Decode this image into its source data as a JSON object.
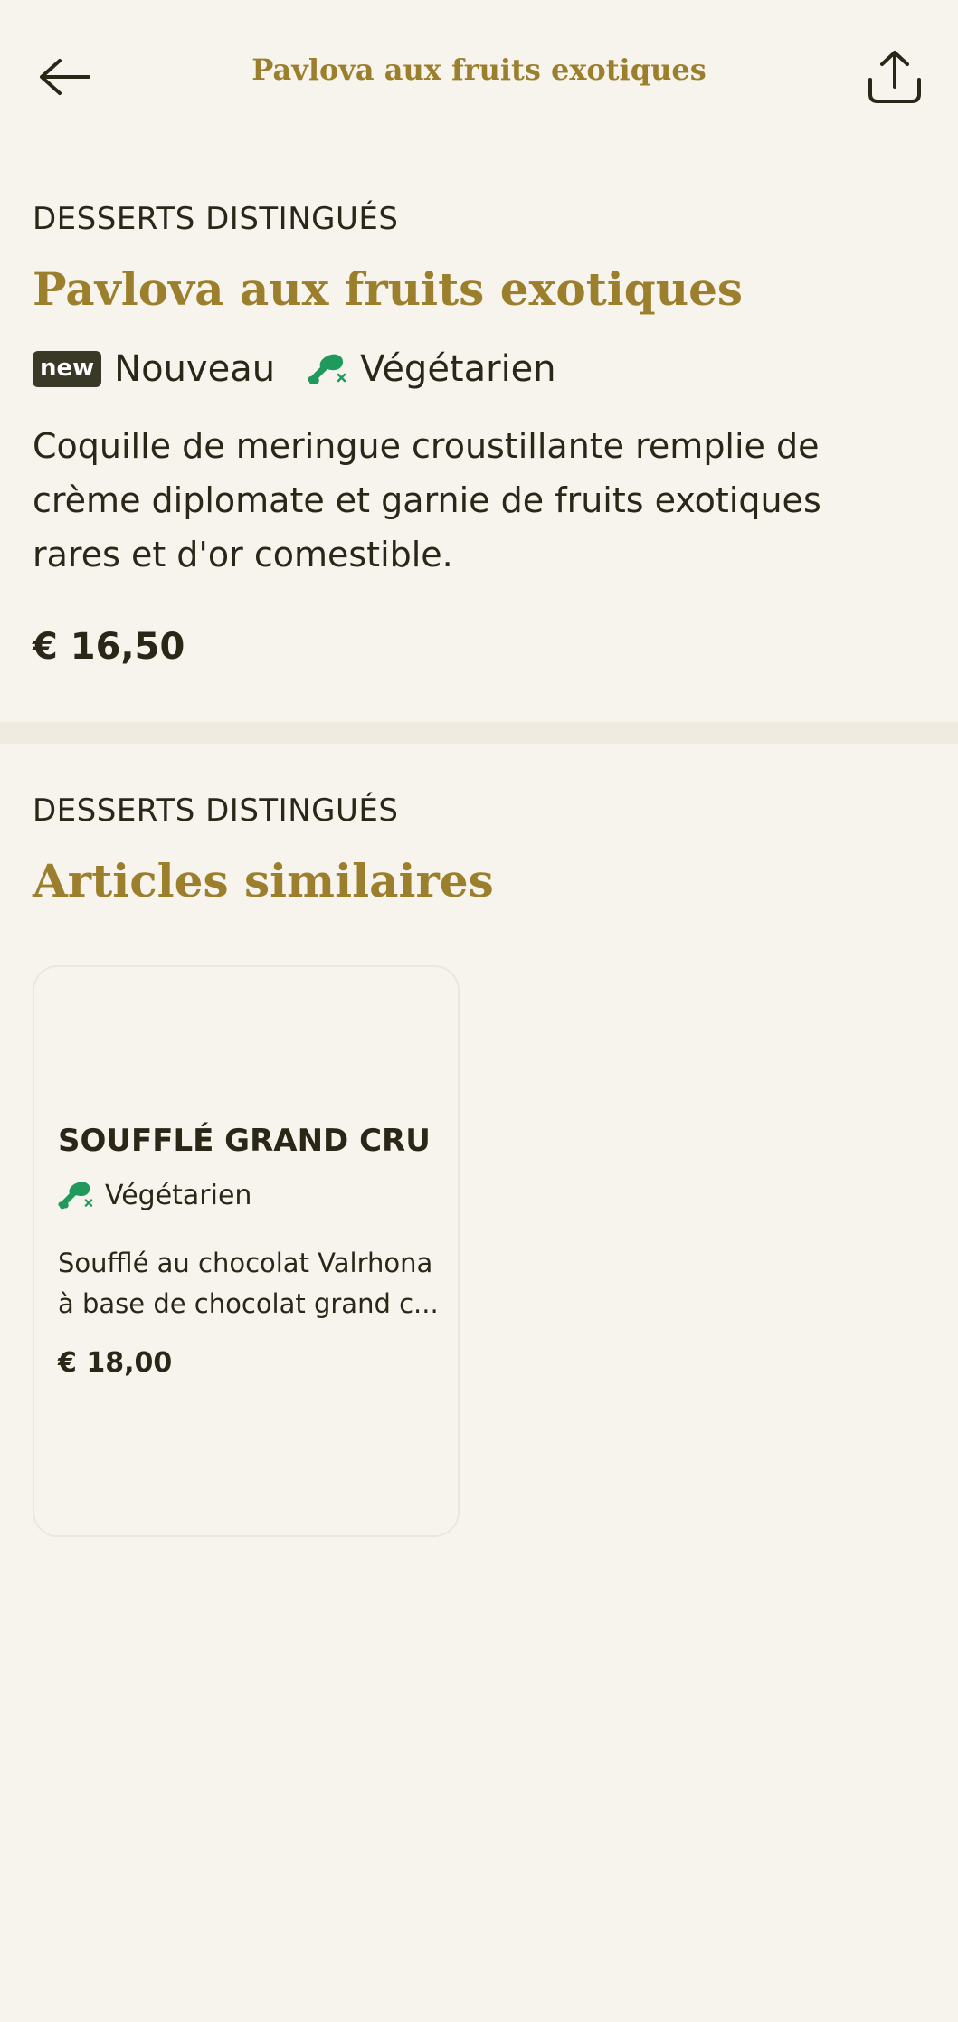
{
  "header": {
    "title": "Pavlova aux fruits exotiques",
    "back_icon": "arrow-left-icon",
    "share_icon": "share-icon"
  },
  "product": {
    "category": "DESSERTS DISTINGUÉS",
    "title": "Pavlova aux fruits exotiques",
    "badge_new": "new",
    "badge_new_label": "Nouveau",
    "badge_veg_label": "Végétarien",
    "veg_icon": "vegetarian-drumstick-icon",
    "description": "Coquille de meringue croustillante remplie de crème diplomate et garnie de fruits exotiques rares et d'or comestible.",
    "price": "€ 16,50"
  },
  "similar": {
    "category": "DESSERTS DISTINGUÉS",
    "title": "Articles similaires",
    "items": [
      {
        "name": "SOUFFLÉ GRAND CRU",
        "badge_veg_label": "Végétarien",
        "description_line1": "Soufflé au chocolat Valrhona",
        "description_line2": "à base de chocolat grand c...",
        "price": "€ 18,00"
      }
    ]
  },
  "colors": {
    "background": "#f7f4ee",
    "accent_gold": "#9c7f2c",
    "text": "#2a2718",
    "veg_green": "#1f9a5c",
    "divider": "#efebe1"
  }
}
